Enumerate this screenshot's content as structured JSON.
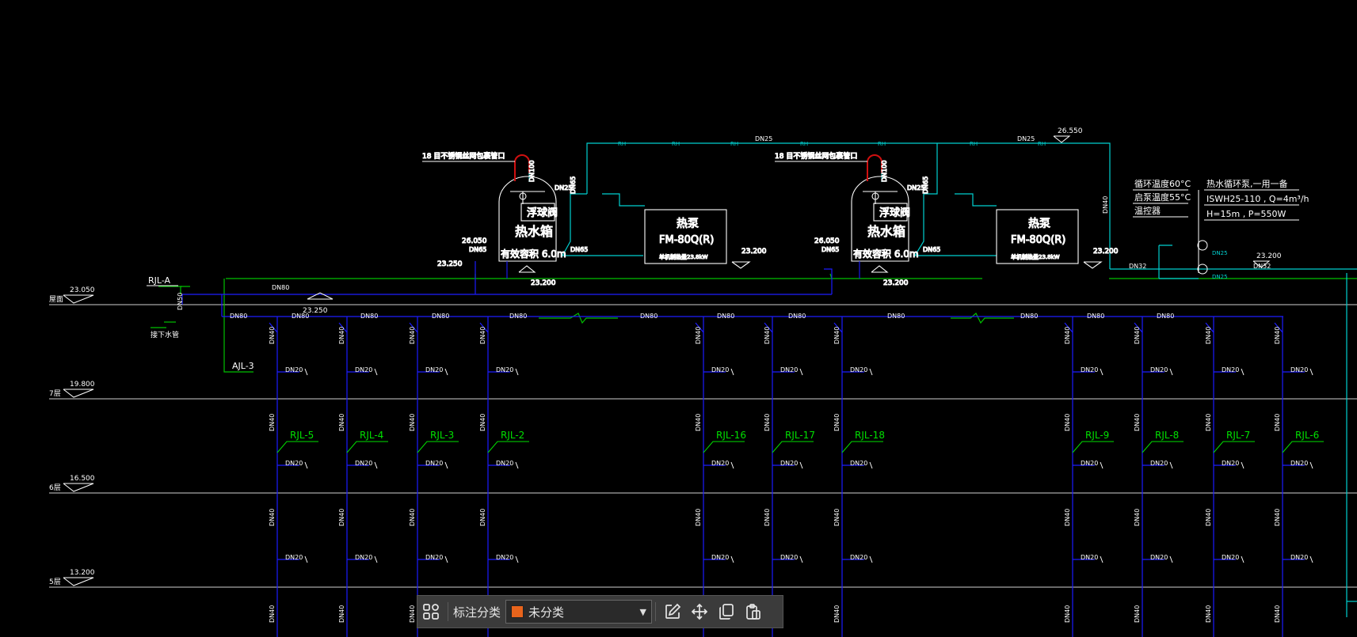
{
  "colors": {
    "bg": "#000000",
    "level_line": "#cfcfcf",
    "supply": "#1c1cff",
    "return": "#00c000",
    "hot": "#00d0d0",
    "text": "#ffffff",
    "riser_label": "#00e000",
    "vent": "#d01010",
    "accent": "#e8641c"
  },
  "floors": [
    {
      "name": "屋面",
      "elev": "23.050"
    },
    {
      "name": "7层",
      "elev": "19.800"
    },
    {
      "name": "6层",
      "elev": "16.500"
    },
    {
      "name": "5层",
      "elev": "13.200"
    }
  ],
  "tank_note": "18 目不锈钢丝网包裹管口",
  "tanks": [
    {
      "valve": "浮球阀",
      "name": "热水箱",
      "vol": "有效容积 6.0m",
      "pipe_top": "DN100",
      "pipe_out": "DN25",
      "pipe_in": "DN65",
      "pipe_side": "DN65",
      "pipe_drain": "DN65",
      "elev_side": "26.050",
      "elev_base": "23.200",
      "elev_pipe": "23.250"
    },
    {
      "valve": "浮球阀",
      "name": "热水箱",
      "vol": "有效容积 6.0m",
      "pipe_top": "DN100",
      "pipe_out": "DN25",
      "pipe_in": "DN65",
      "pipe_side": "DN65",
      "pipe_drain": "DN65",
      "elev_side": "26.050",
      "elev_base": "23.200",
      "elev_pipe": ""
    }
  ],
  "heat_pumps": [
    {
      "title": "热泵",
      "model": "FM-80Q(R)",
      "power": "单机制热量23.8kW",
      "elev": "23.200"
    },
    {
      "title": "热泵",
      "model": "FM-80Q(R)",
      "power": "单机制热量23.8kW",
      "elev": "23.200"
    }
  ],
  "top_pipe": {
    "label1": "DN25",
    "label2": "DN25",
    "elev": "26.550",
    "tag": "RH"
  },
  "spec": {
    "left": [
      "循环温度60°C",
      "启泵温度55°C",
      "温控器"
    ],
    "right": [
      "热水循环泵,一用一备",
      "ISWH25-110 , Q=4m³/h",
      "H=15m , P=550W"
    ]
  },
  "pump_station": {
    "pipe_in": "DN32",
    "pipe_out": "DN32",
    "elev": "23.200",
    "pump_dn": "DN25",
    "riser": "DN40"
  },
  "main_labels": {
    "rjl_a": "RJL-A",
    "ajl_3": "AJL-3",
    "bottom_note": "接下水管",
    "dn50": "DN50",
    "dn80": "DN80",
    "elev_main": "23.250"
  },
  "header_labels": [
    "DN80",
    "DN80",
    "DN80",
    "DN80",
    "DN80",
    "DN80",
    "DN80",
    "DN80",
    "DN80",
    "DN80",
    "DN80",
    "DN80"
  ],
  "risers": [
    {
      "id": "RJL-5"
    },
    {
      "id": "RJL-4"
    },
    {
      "id": "RJL-3"
    },
    {
      "id": "RJL-2"
    },
    {
      "id": "RJL-16"
    },
    {
      "id": "RJL-17"
    },
    {
      "id": "RJL-18"
    },
    {
      "id": "RJL-9"
    },
    {
      "id": "RJL-8"
    },
    {
      "id": "RJL-7"
    },
    {
      "id": "RJL-6"
    }
  ],
  "riser_pipe": "DN40",
  "branch_pipe": "DN20",
  "toolbar": {
    "annotate_label": "标注分类",
    "category_value": "未分类",
    "category_color": "#e8641c",
    "icons": [
      "grid-icon",
      "edit-icon",
      "move-icon",
      "copy-icon",
      "paste-icon"
    ]
  }
}
